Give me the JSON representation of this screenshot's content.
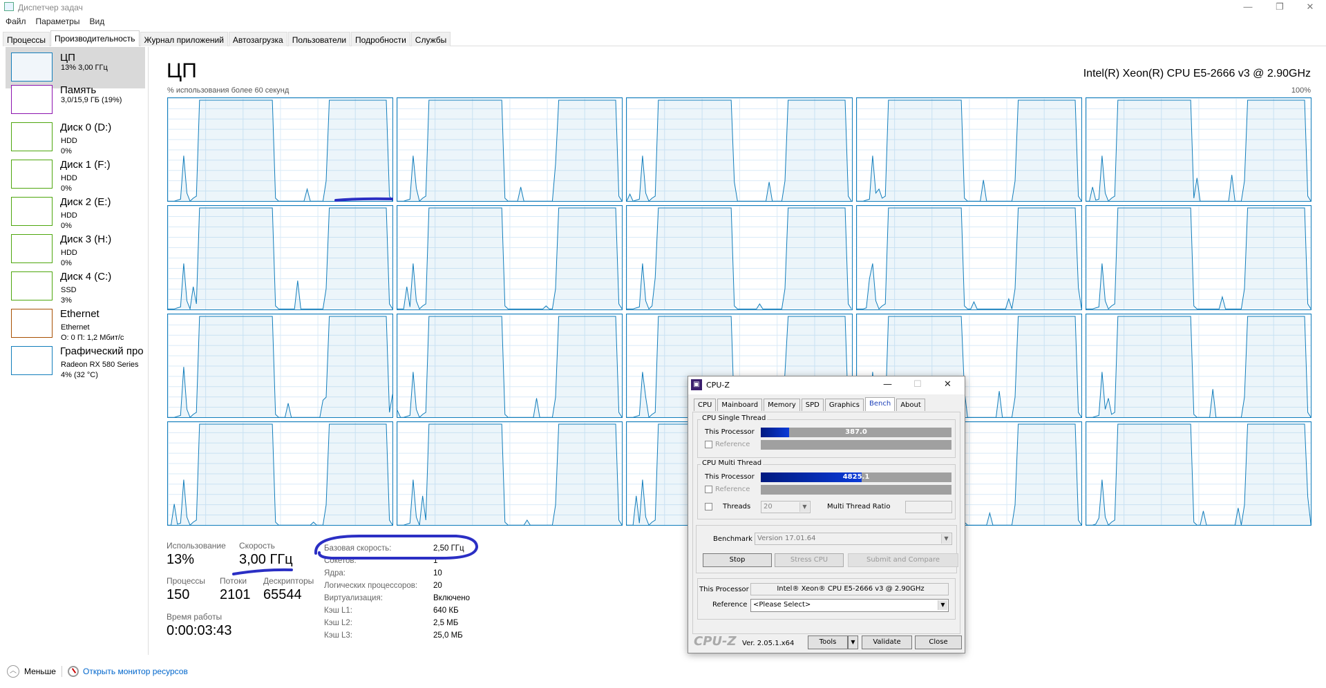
{
  "window": {
    "title": "Диспетчер задач",
    "minimize": "—",
    "restore": "❐",
    "close": "✕"
  },
  "menu": [
    "Файл",
    "Параметры",
    "Вид"
  ],
  "tabs": [
    "Процессы",
    "Производительность",
    "Журнал приложений",
    "Автозагрузка",
    "Пользователи",
    "Подробности",
    "Службы"
  ],
  "active_tab": 1,
  "sidebar": [
    {
      "name": "ЦП",
      "sub1": "13% 3,00 ГГц",
      "color": "#117dbb"
    },
    {
      "name": "Память",
      "sub1": "3,0/15,9 ГБ (19%)",
      "color": "#8b12ae"
    },
    {
      "name": "Диск 0 (D:)",
      "sub1": "HDD",
      "sub2": "0%",
      "color": "#4da60c"
    },
    {
      "name": "Диск 1 (F:)",
      "sub1": "HDD",
      "sub2": "0%",
      "color": "#4da60c"
    },
    {
      "name": "Диск 2 (E:)",
      "sub1": "HDD",
      "sub2": "0%",
      "color": "#4da60c"
    },
    {
      "name": "Диск 3 (H:)",
      "sub1": "HDD",
      "sub2": "0%",
      "color": "#4da60c"
    },
    {
      "name": "Диск 4 (C:)",
      "sub1": "SSD",
      "sub2": "3%",
      "color": "#4da60c"
    },
    {
      "name": "Ethernet",
      "sub1": "Ethernet",
      "sub2": "О: 0 П: 1,2 Мбит/с",
      "color": "#a74f01"
    },
    {
      "name": "Графический про",
      "sub1": "Radeon RX 580 Series",
      "sub2": "4% (32 °C)",
      "color": "#117dbb"
    }
  ],
  "main": {
    "title": "ЦП",
    "cpu_name": "Intel(R) Xeon(R) CPU E5-2666 v3 @ 2.90GHz",
    "axis_label": "% использования более 60 секунд",
    "axis_max": "100%",
    "line_color": "#117dbb"
  },
  "core_usage_pattern": [
    0,
    0,
    0,
    1,
    2,
    45,
    8,
    0,
    3,
    5,
    100,
    100,
    100,
    100,
    100,
    100,
    100,
    100,
    100,
    100,
    100,
    100,
    100,
    100,
    100,
    100,
    100,
    100,
    100,
    100,
    100,
    100,
    100,
    100,
    3,
    0,
    0,
    0,
    0,
    0,
    0,
    0,
    0,
    0,
    0,
    0,
    0,
    0,
    0,
    0,
    20,
    100,
    100,
    100,
    100,
    100,
    100,
    100,
    100,
    100,
    100,
    100,
    100,
    100,
    100,
    100,
    100,
    100,
    100,
    100,
    5,
    0
  ],
  "logical_processors": 20,
  "stats": {
    "usage_label": "Использование",
    "usage": "13%",
    "speed_label": "Скорость",
    "speed": "3,00 ГГц",
    "processes_label": "Процессы",
    "processes": "150",
    "threads_label": "Потоки",
    "threads": "2101",
    "handles_label": "Дескрипторы",
    "handles": "65544",
    "uptime_label": "Время работы",
    "uptime": "0:00:03:43"
  },
  "details": [
    {
      "k": "Базовая скорость:",
      "v": "2,50 ГГц"
    },
    {
      "k": "Сокетов:",
      "v": "1"
    },
    {
      "k": "Ядра:",
      "v": "10"
    },
    {
      "k": "Логических процессоров:",
      "v": "20"
    },
    {
      "k": "Виртуализация:",
      "v": "Включено"
    },
    {
      "k": "Кэш L1:",
      "v": "640 КБ"
    },
    {
      "k": "Кэш L2:",
      "v": "2,5 МБ"
    },
    {
      "k": "Кэш L3:",
      "v": "25,0 МБ"
    }
  ],
  "footer": {
    "less": "Меньше",
    "resmon": "Открыть монитор ресурсов"
  },
  "cpuz": {
    "title": "CPU-Z",
    "tabs": [
      "CPU",
      "Mainboard",
      "Memory",
      "SPD",
      "Graphics",
      "Bench",
      "About"
    ],
    "single_caption": "CPU Single Thread",
    "multi_caption": "CPU Multi Thread",
    "this_processor": "This Processor",
    "reference": "Reference",
    "single_score": "387.0",
    "single_fraction": 0.15,
    "multi_score": "4825.1",
    "multi_fraction": 0.53,
    "threads_label": "Threads",
    "threads_value": "20",
    "ratio_label": "Multi Thread Ratio",
    "benchmark_label": "Benchmark",
    "benchmark_version": "Version 17.01.64",
    "stop": "Stop",
    "stress": "Stress CPU",
    "submit": "Submit and Compare",
    "processor_name": "Intel® Xeon® CPU E5-2666 v3 @ 2.90GHz",
    "reference_select": "<Please Select>",
    "logo": "CPU-Z",
    "version": "Ver. 2.05.1.x64",
    "tools": "Tools",
    "validate": "Validate",
    "close": "Close"
  }
}
